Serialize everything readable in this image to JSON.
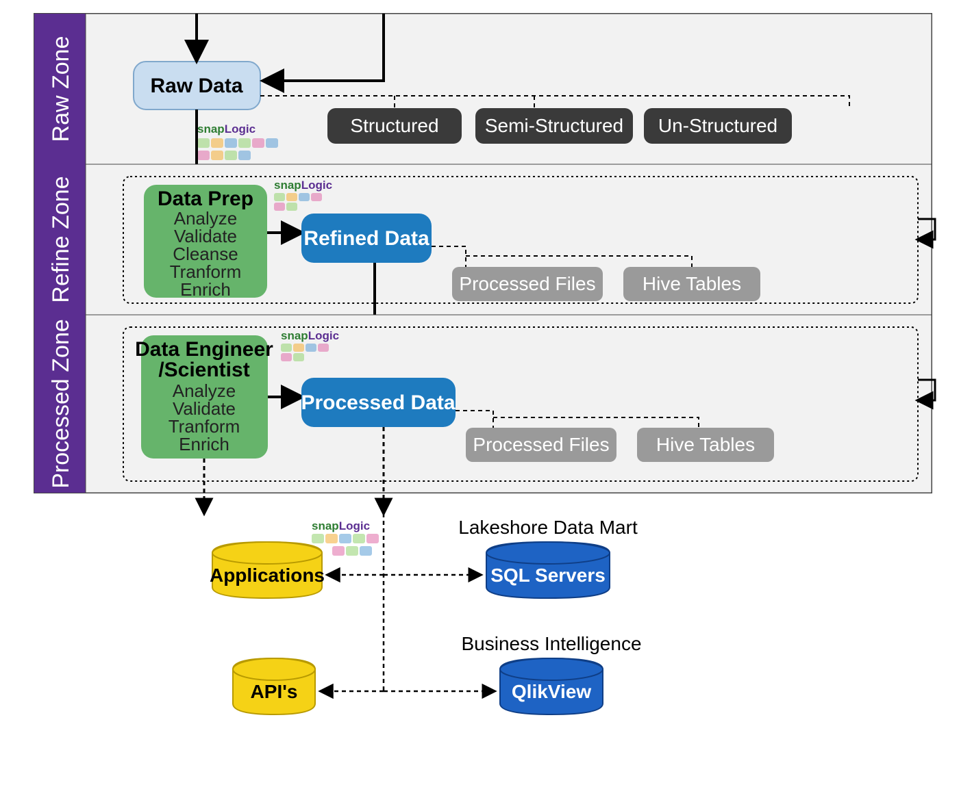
{
  "colors": {
    "purple": "#5B2E91",
    "lightBlue": "#C9DDF0",
    "darkPill": "#3A3A3A",
    "green": "#66B46B",
    "blue": "#1E7BBF",
    "gray": "#9A9A9A",
    "yellow": "#F5D216",
    "cylBlue": "#1E63C4",
    "snapGreen": "#2E7D32",
    "snapPurple": "#5B2E91"
  },
  "zones": {
    "raw": {
      "label": "Raw Zone"
    },
    "refine": {
      "label": "Refine Zone"
    },
    "processed": {
      "label": "Processed Zone"
    }
  },
  "rawData": {
    "title": "Raw Data"
  },
  "dataTypes": [
    "Structured",
    "Semi-Structured",
    "Un-Structured"
  ],
  "dataPrep": {
    "title": "Data Prep",
    "items": [
      "Analyze",
      "Validate",
      "Cleanse",
      "Tranform",
      "Enrich"
    ]
  },
  "refinedData": {
    "title": "Refined Data"
  },
  "refineOutputs": [
    "Processed Files",
    "Hive Tables"
  ],
  "dataEngineer": {
    "title": "Data Engineer /Scientist",
    "items": [
      "Analyze",
      "Validate",
      "Tranform",
      "Enrich"
    ]
  },
  "processedData": {
    "title": "Processed Data"
  },
  "processedOutputs": [
    "Processed Files",
    "Hive Tables"
  ],
  "bottom": {
    "applications": "Applications",
    "apis": "API's",
    "lakeshore": "Lakeshore Data Mart",
    "sqlServers": "SQL Servers",
    "bi": "Business Intelligence",
    "qlikview": "QlikView"
  },
  "snap": {
    "prefix": "snap",
    "suffix": "Logic"
  }
}
